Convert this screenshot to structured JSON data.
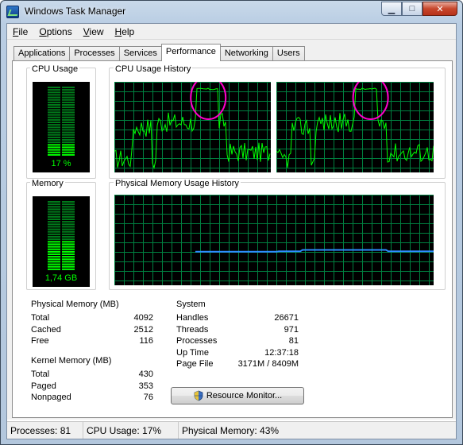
{
  "window": {
    "title": "Windows Task Manager"
  },
  "menu": [
    {
      "key": "F",
      "rest": "ile"
    },
    {
      "key": "O",
      "rest": "ptions"
    },
    {
      "key": "V",
      "rest": "iew"
    },
    {
      "key": "H",
      "rest": "elp"
    }
  ],
  "tabs": [
    "Applications",
    "Processes",
    "Services",
    "Performance",
    "Networking",
    "Users"
  ],
  "active_tab": "Performance",
  "cpu": {
    "label": "CPU Usage",
    "value_text": "17 %",
    "level": 0.17
  },
  "cpu_history": {
    "label": "CPU Usage History"
  },
  "memory": {
    "label": "Memory",
    "value_text": "1,74 GB",
    "level": 0.43
  },
  "mem_history": {
    "label": "Physical Memory Usage History"
  },
  "physical_memory": {
    "title": "Physical Memory (MB)",
    "rows": [
      {
        "label": "Total",
        "value": "4092"
      },
      {
        "label": "Cached",
        "value": "2512"
      },
      {
        "label": "Free",
        "value": "116"
      }
    ]
  },
  "kernel_memory": {
    "title": "Kernel Memory (MB)",
    "rows": [
      {
        "label": "Total",
        "value": "430"
      },
      {
        "label": "Paged",
        "value": "353"
      },
      {
        "label": "Nonpaged",
        "value": "76"
      }
    ]
  },
  "system": {
    "title": "System",
    "rows": [
      {
        "label": "Handles",
        "value": "26671"
      },
      {
        "label": "Threads",
        "value": "971"
      },
      {
        "label": "Processes",
        "value": "81"
      },
      {
        "label": "Up Time",
        "value": "12:37:18"
      },
      {
        "label": "Page File",
        "value": "3171M / 8409M"
      }
    ]
  },
  "resource_monitor_button": "Resource Monitor...",
  "statusbar": {
    "processes": "Processes: 81",
    "cpu_usage": "CPU Usage: 17%",
    "physical_memory": "Physical Memory: 43%"
  },
  "colors": {
    "graph_bg": "#000000",
    "grid": "#008040",
    "cpu_line": "#00ff00",
    "mem_line": "#2d8cff",
    "highlight": "#ff00cc"
  }
}
